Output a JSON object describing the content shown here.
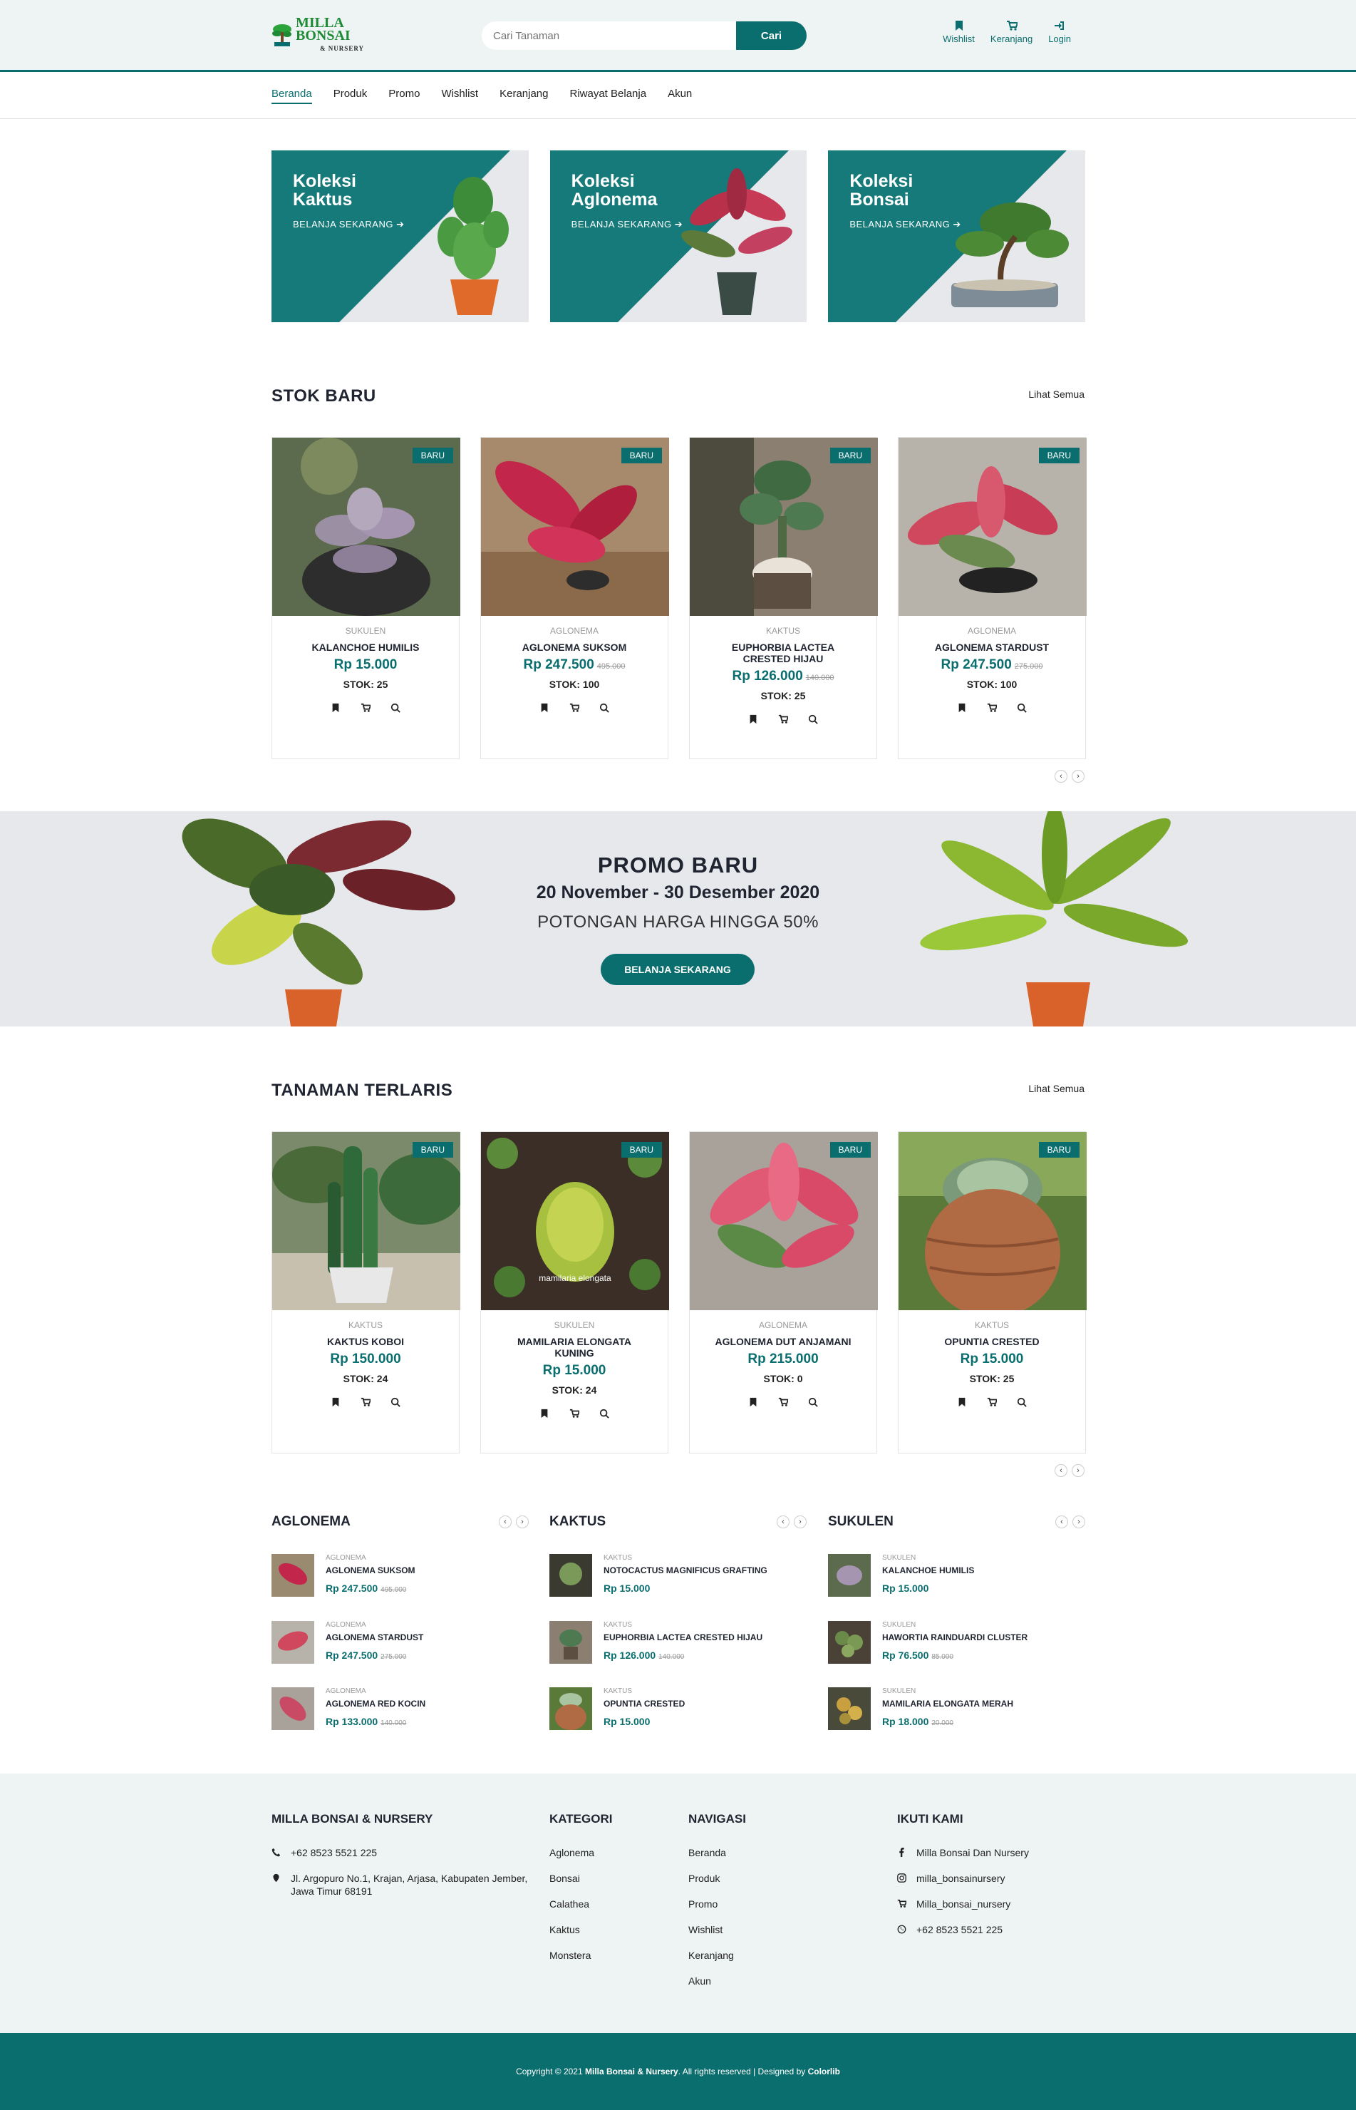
{
  "header": {
    "logo_text": "MILLA BONSAI",
    "logo_sub": "& NURSERY",
    "search_placeholder": "Cari Tanaman",
    "search_button": "Cari",
    "icons": [
      {
        "label": "Wishlist",
        "icon": "bookmark-icon"
      },
      {
        "label": "Keranjang",
        "icon": "cart-icon"
      },
      {
        "label": "Login",
        "icon": "login-icon"
      }
    ]
  },
  "nav": {
    "items": [
      "Beranda",
      "Produk",
      "Promo",
      "Wishlist",
      "Keranjang",
      "Riwayat Belanja",
      "Akun"
    ],
    "active": "Beranda"
  },
  "banners": [
    {
      "title": "Koleksi Kaktus",
      "cta": "BELANJA SEKARANG"
    },
    {
      "title": "Koleksi Aglonema",
      "cta": "BELANJA SEKARANG"
    },
    {
      "title": "Koleksi Bonsai",
      "cta": "BELANJA SEKARANG"
    }
  ],
  "stok_baru": {
    "title": "STOK BARU",
    "link": "Lihat Semua",
    "products": [
      {
        "badge": "BARU",
        "category": "SUKULEN",
        "name": "KALANCHOE HUMILIS",
        "price": "Rp 15.000",
        "old_price": "",
        "stock": "STOK: 25"
      },
      {
        "badge": "BARU",
        "category": "AGLONEMA",
        "name": "AGLONEMA SUKSOM",
        "price": "Rp 247.500",
        "old_price": "495.000",
        "stock": "STOK: 100"
      },
      {
        "badge": "BARU",
        "category": "KAKTUS",
        "name": "EUPHORBIA LACTEA CRESTED HIJAU",
        "price": "Rp 126.000",
        "old_price": "140.000",
        "stock": "STOK: 25"
      },
      {
        "badge": "BARU",
        "category": "AGLONEMA",
        "name": "AGLONEMA STARDUST",
        "price": "Rp 247.500",
        "old_price": "275.000",
        "stock": "STOK: 100"
      }
    ]
  },
  "promo": {
    "title": "PROMO BARU",
    "dates": "20 November - 30 Desember 2020",
    "subtitle": "POTONGAN HARGA HINGGA 50%",
    "button": "BELANJA SEKARANG"
  },
  "terlaris": {
    "title": "TANAMAN TERLARIS",
    "link": "Lihat Semua",
    "products": [
      {
        "badge": "BARU",
        "category": "KAKTUS",
        "name": "KAKTUS KOBOI",
        "price": "Rp 150.000",
        "old_price": "",
        "stock": "STOK: 24"
      },
      {
        "badge": "BARU",
        "category": "SUKULEN",
        "name": "MAMILARIA ELONGATA KUNING",
        "price": "Rp 15.000",
        "old_price": "",
        "stock": "STOK: 24",
        "img_caption": "mamilaria elongata"
      },
      {
        "badge": "BARU",
        "category": "AGLONEMA",
        "name": "AGLONEMA DUT ANJAMANI",
        "price": "Rp 215.000",
        "old_price": "",
        "stock": "STOK: 0"
      },
      {
        "badge": "BARU",
        "category": "KAKTUS",
        "name": "OPUNTIA CRESTED",
        "price": "Rp 15.000",
        "old_price": "",
        "stock": "STOK: 25"
      }
    ]
  },
  "categories": [
    {
      "title": "AGLONEMA",
      "items": [
        {
          "category": "AGLONEMA",
          "name": "AGLONEMA SUKSOM",
          "price": "Rp 247.500",
          "old_price": "495.000"
        },
        {
          "category": "AGLONEMA",
          "name": "AGLONEMA STARDUST",
          "price": "Rp 247.500",
          "old_price": "275.000"
        },
        {
          "category": "AGLONEMA",
          "name": "AGLONEMA RED KOCIN",
          "price": "Rp 133.000",
          "old_price": "140.000"
        }
      ]
    },
    {
      "title": "KAKTUS",
      "items": [
        {
          "category": "KAKTUS",
          "name": "NOTOCACTUS MAGNIFICUS GRAFTING",
          "price": "Rp 15.000",
          "old_price": ""
        },
        {
          "category": "KAKTUS",
          "name": "EUPHORBIA LACTEA CRESTED HIJAU",
          "price": "Rp 126.000",
          "old_price": "140.000"
        },
        {
          "category": "KAKTUS",
          "name": "OPUNTIA CRESTED",
          "price": "Rp 15.000",
          "old_price": ""
        }
      ]
    },
    {
      "title": "SUKULEN",
      "items": [
        {
          "category": "SUKULEN",
          "name": "KALANCHOE HUMILIS",
          "price": "Rp 15.000",
          "old_price": ""
        },
        {
          "category": "SUKULEN",
          "name": "HAWORTIA RAINDUARDI CLUSTER",
          "price": "Rp 76.500",
          "old_price": "85.000"
        },
        {
          "category": "SUKULEN",
          "name": "MAMILARIA ELONGATA MERAH",
          "price": "Rp 18.000",
          "old_price": "20.000"
        }
      ]
    }
  ],
  "footer": {
    "brand": {
      "title": "MILLA BONSAI & NURSERY",
      "phone": "+62 8523 5521 225",
      "address": "Jl. Argopuro No.1, Krajan, Arjasa, Kabupaten Jember, Jawa Timur 68191"
    },
    "kategori": {
      "title": "KATEGORI",
      "items": [
        "Aglonema",
        "Bonsai",
        "Calathea",
        "Kaktus",
        "Monstera"
      ]
    },
    "navigasi": {
      "title": "NAVIGASI",
      "items": [
        "Beranda",
        "Produk",
        "Promo",
        "Wishlist",
        "Keranjang",
        "Akun"
      ]
    },
    "ikuti": {
      "title": "IKUTI KAMI",
      "items": [
        {
          "icon": "facebook-icon",
          "label": "Milla Bonsai Dan Nursery"
        },
        {
          "icon": "instagram-icon",
          "label": "milla_bonsainursery"
        },
        {
          "icon": "cart-icon",
          "label": "Milla_bonsai_nursery"
        },
        {
          "icon": "whatsapp-icon",
          "label": "+62 8523 5521 225"
        }
      ]
    },
    "copyright_prefix": "Copyright © 2021",
    "copyright_brand": "Milla Bonsai & Nursery",
    "copyright_mid": ". All rights reserved | Designed by",
    "copyright_designer": "Colorlib"
  },
  "colors": {
    "teal": "#0b6e6e",
    "light_bg": "#eef4f3",
    "banner_bg": "#e6e8ec"
  }
}
